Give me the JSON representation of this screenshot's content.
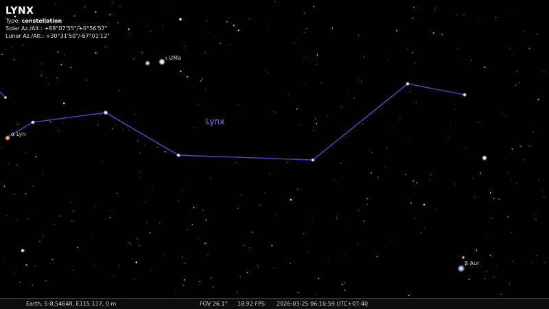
{
  "object_info": {
    "title": "LYNX",
    "type_label": "Type:",
    "type_value": "constellation",
    "solar": "Solar Az./Alt.: +88°07'55\"/+0°56'57\"",
    "lunar": "Lunar Az./Alt.: +30°31'50\"/-67°01'12\""
  },
  "labels": {
    "constellation": "Lynx",
    "iota_uma": "ι UMa",
    "alpha_lyn": "α Lyn",
    "beta_aur": "β Aur"
  },
  "status_bar": {
    "location": "Earth, S-8.54648, E115.117, 0 m",
    "fov": "FOV 26.1°",
    "fps": "18.92 FPS",
    "datetime": "2026-03-25 06:10:59 UTC+07:40"
  },
  "colors": {
    "sky": "#000000",
    "constellation_line": "#4a4fc7",
    "constellation_label": "#6f84d8"
  }
}
